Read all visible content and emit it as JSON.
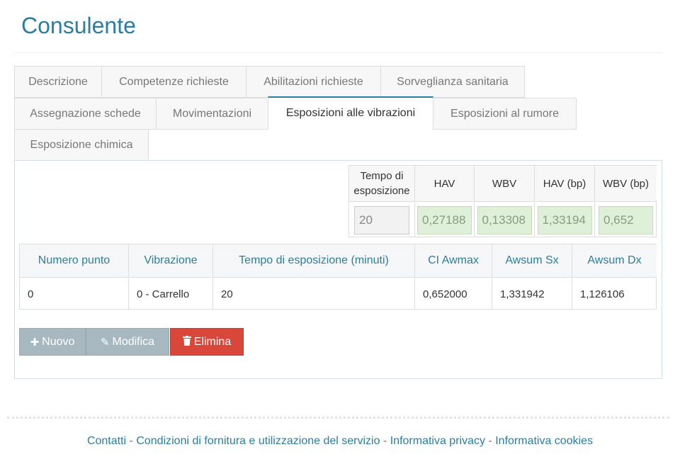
{
  "page": {
    "title": "Consulente"
  },
  "tabs": [
    {
      "label": "Descrizione"
    },
    {
      "label": "Competenze richieste"
    },
    {
      "label": "Abilitazioni richieste"
    },
    {
      "label": "Sorveglianza sanitaria"
    },
    {
      "label": "Assegnazione schede"
    },
    {
      "label": "Movimentazioni"
    },
    {
      "label": "Esposizioni alle vibrazioni",
      "active": true
    },
    {
      "label": "Esposizioni al rumore"
    },
    {
      "label": "Esposizione chimica"
    }
  ],
  "summary": {
    "headers": [
      "Tempo di\nesposizione",
      "HAV",
      "WBV",
      "HAV (bp)",
      "WBV (bp)"
    ],
    "head_line1": "Tempo di",
    "head_line2": "esposizione",
    "values": [
      "20",
      "0,27188",
      "0,13308",
      "1,33194",
      "0,652"
    ]
  },
  "table": {
    "headers": [
      "Numero punto",
      "Vibrazione",
      "Tempo di esposizione (minuti)",
      "CI Awmax",
      "Awsum Sx",
      "Awsum Dx"
    ],
    "rows": [
      [
        "0",
        "0 - Carrello",
        "20",
        "0,652000",
        "1,331942",
        "1,126106"
      ]
    ]
  },
  "buttons": {
    "new": "Nuovo",
    "edit": "Modifica",
    "delete": "Elimina"
  },
  "footer": {
    "links": [
      "Contatti",
      "Condizioni di fornitura e utilizzazione del servizio",
      "Informativa privacy",
      "Informativa cookies"
    ],
    "separator": "-"
  },
  "colors": {
    "accent": "#2b7ea1",
    "danger": "#d9473b",
    "muted_button": "#a8b8c1",
    "success_field": "#dff0d8"
  },
  "icons": {
    "new": "plus-icon",
    "edit": "edit-icon",
    "delete": "trash-icon"
  }
}
